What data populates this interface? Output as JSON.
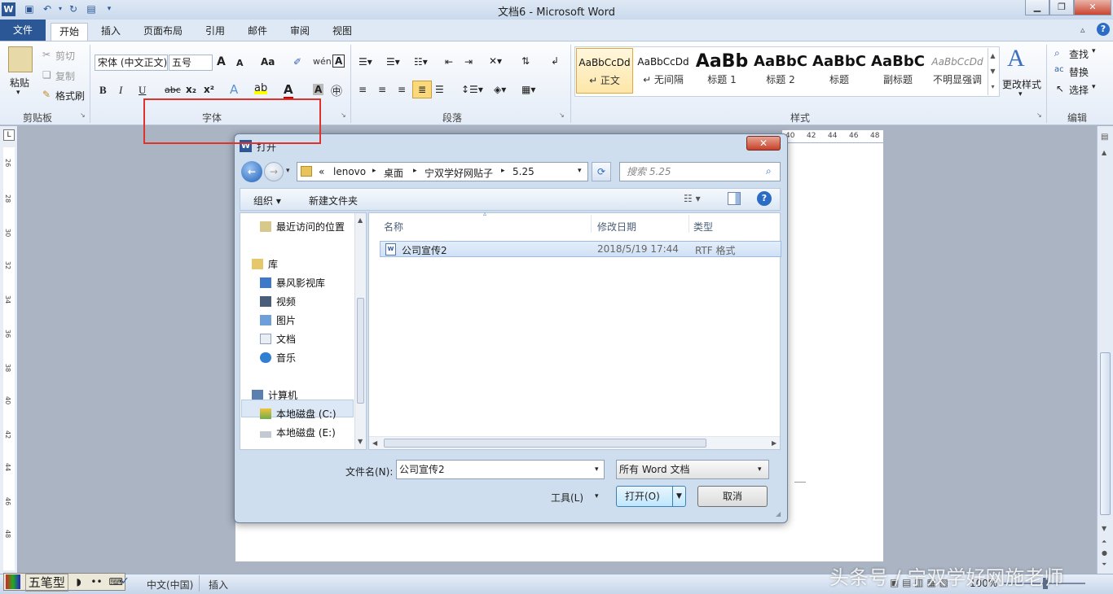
{
  "app": {
    "title": "文档6 - Microsoft Word"
  },
  "tabs": [
    {
      "label": "文件"
    },
    {
      "label": "开始"
    },
    {
      "label": "插入"
    },
    {
      "label": "页面布局"
    },
    {
      "label": "引用"
    },
    {
      "label": "邮件"
    },
    {
      "label": "审阅"
    },
    {
      "label": "视图"
    }
  ],
  "clipboard": {
    "paste": "粘贴",
    "cut": "剪切",
    "copy": "复制",
    "format_painter": "格式刷",
    "group": "剪贴板"
  },
  "font": {
    "name": "宋体 (中文正文)",
    "size": "五号",
    "group": "字体",
    "bold": "B",
    "italic": "I",
    "underline": "U",
    "strike": "abc",
    "sub": "x₂",
    "sup": "x²",
    "grow": "A",
    "shrink": "A",
    "case": "Aa",
    "clear": "A"
  },
  "paragraph": {
    "group": "段落"
  },
  "styles": {
    "group": "样式",
    "items": [
      {
        "sample": "AaBbCcDd",
        "name": "↵ 正文"
      },
      {
        "sample": "AaBbCcDd",
        "name": "↵ 无间隔"
      },
      {
        "sample": "AaBb",
        "name": "标题 1"
      },
      {
        "sample": "AaBbC",
        "name": "标题 2"
      },
      {
        "sample": "AaBbC",
        "name": "标题"
      },
      {
        "sample": "AaBbC",
        "name": "副标题"
      },
      {
        "sample": "AaBbCcDd",
        "name": "不明显强调"
      }
    ],
    "change": "更改样式"
  },
  "editing": {
    "find": "查找",
    "replace": "替换",
    "select": "选择",
    "group": "编辑"
  },
  "ruler": {
    "left_ticks": [
      "26",
      "28",
      "30",
      "32",
      "34",
      "36",
      "38",
      "40",
      "42",
      "44",
      "46",
      "48"
    ],
    "top_ticks": [
      "40",
      "42",
      "44",
      "46",
      "48"
    ]
  },
  "dialog": {
    "title": "打开",
    "breadcrumb": [
      "«",
      "lenovo",
      "桌面",
      "宁双学好网贴子",
      "5.25"
    ],
    "search_placeholder": "搜索 5.25",
    "organize": "组织 ▾",
    "new_folder": "新建文件夹",
    "nav": [
      {
        "label": "最近访问的位置",
        "icon": "recent-places-icon"
      },
      {
        "label": "库",
        "icon": "library-icon"
      },
      {
        "label": "暴风影视库",
        "icon": "video-library-icon"
      },
      {
        "label": "视频",
        "icon": "video-icon"
      },
      {
        "label": "图片",
        "icon": "pictures-icon"
      },
      {
        "label": "文档",
        "icon": "documents-icon"
      },
      {
        "label": "音乐",
        "icon": "music-icon"
      },
      {
        "label": "计算机",
        "icon": "computer-icon"
      },
      {
        "label": "本地磁盘 (C:)",
        "icon": "drive-icon"
      },
      {
        "label": "本地磁盘 (E:)",
        "icon": "drive-icon"
      }
    ],
    "columns": {
      "name": "名称",
      "date": "修改日期",
      "type": "类型"
    },
    "files": [
      {
        "name": "公司宣传2",
        "date": "2018/5/19 17:44",
        "type": "RTF 格式"
      }
    ],
    "filename_label": "文件名(N):",
    "filename_value": "公司宣传2",
    "filetype_value": "所有 Word 文档",
    "tools": "工具(L)",
    "open": "打开(O)",
    "cancel": "取消"
  },
  "status": {
    "ime_name": "五笔型",
    "language": "中文(中国)",
    "mode": "插入",
    "zoom": "100%"
  },
  "watermark": "头条号 / 宁双学好网施老师"
}
